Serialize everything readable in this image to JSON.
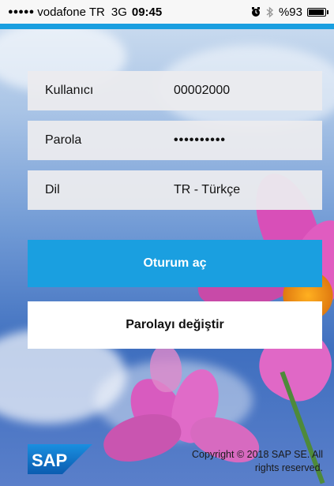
{
  "status_bar": {
    "signal_dots": "●●●●●",
    "carrier": "vodafone TR",
    "network": "3G",
    "time": "09:45",
    "alarm_icon": "alarm-icon",
    "bluetooth_icon": "bluetooth-icon",
    "battery_percent": "%93",
    "battery_level": 0.93
  },
  "login_form": {
    "user_label": "Kullanıcı",
    "user_value": "00002000",
    "password_label": "Parola",
    "password_value": "••••••••••",
    "language_label": "Dil",
    "language_value": "TR - Türkçe"
  },
  "actions": {
    "login_label": "Oturum aç",
    "change_password_label": "Parolayı değiştir"
  },
  "footer": {
    "logo_text": "SAP",
    "copyright_line1": "Copyright © 2018 SAP SE. All",
    "copyright_line2": "rights reserved."
  },
  "colors": {
    "accent": "#1a9fe0",
    "logo_blue": "#1473c9"
  }
}
